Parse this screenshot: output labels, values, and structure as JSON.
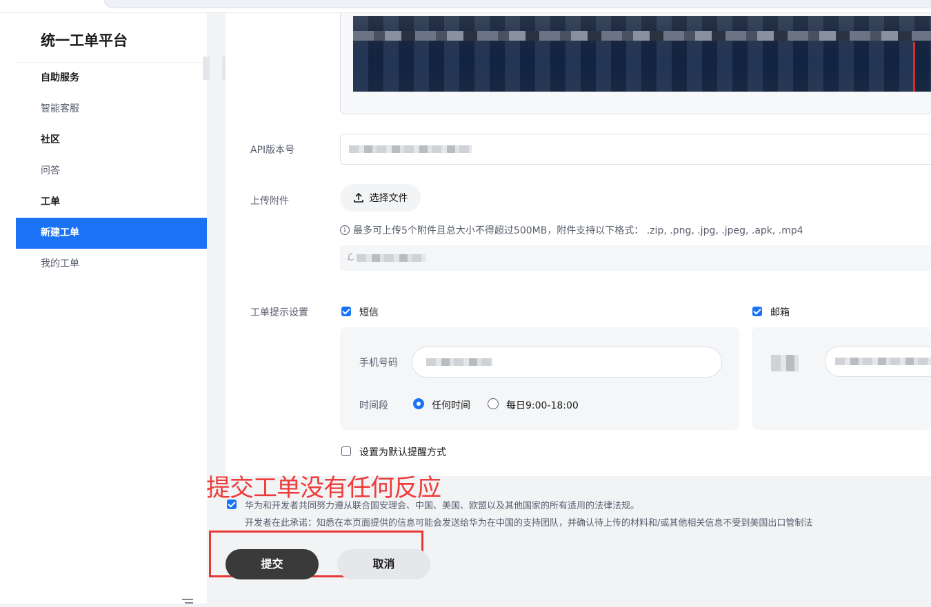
{
  "sidebar": {
    "brand": "统一工单平台",
    "items": [
      {
        "label": "自助服务",
        "kind": "group"
      },
      {
        "label": "智能客服",
        "kind": "link"
      },
      {
        "label": "社区",
        "kind": "group"
      },
      {
        "label": "问答",
        "kind": "link"
      },
      {
        "label": "工单",
        "kind": "group"
      },
      {
        "label": "新建工单",
        "kind": "link",
        "active": true
      },
      {
        "label": "我的工单",
        "kind": "link"
      }
    ]
  },
  "form": {
    "api_version_label": "API版本号",
    "attachment_label": "上传附件",
    "upload_button_label": "选择文件",
    "upload_hint": "最多可上传5个附件且总大小不得超过500MB，附件支持以下格式：  .zip, .png, .jpg, .jpeg, .apk, .mp4",
    "notice_label": "工单提示设置",
    "sms": {
      "label": "短信",
      "checked": true
    },
    "email": {
      "label": "邮箱",
      "checked": true
    },
    "phone_label": "手机号码",
    "time_label": "时间段",
    "time_options": [
      {
        "label": "任何时间",
        "selected": true
      },
      {
        "label": "每日9:00-18:00",
        "selected": false
      }
    ],
    "default_reminder": {
      "label": "设置为默认提醒方式",
      "checked": false
    }
  },
  "legal": {
    "agree_checked": true,
    "line1": "华为和开发者共同努力遵从联合国安理会、中国、美国、欧盟以及其他国家的所有适用的法律法规。",
    "line2": "开发者在此承诺：知悉在本页面提供的信息可能会发送给华为在中国的支持团队，并确认待上传的材料和/或其他相关信息不受到美国出口管制法"
  },
  "actions": {
    "submit_label": "提交",
    "cancel_label": "取消"
  },
  "annotation": {
    "text": "提交工单没有任何反应",
    "color": "#f03b3b"
  },
  "colors": {
    "primary": "#1a73f5",
    "submit_bg": "#3a3a3a"
  }
}
